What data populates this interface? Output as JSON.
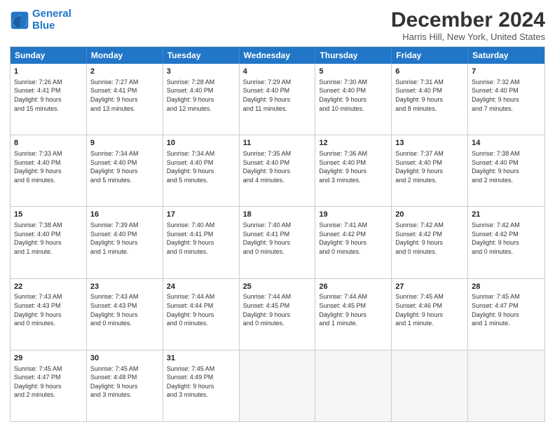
{
  "logo": {
    "line1": "General",
    "line2": "Blue"
  },
  "title": "December 2024",
  "location": "Harris Hill, New York, United States",
  "days_of_week": [
    "Sunday",
    "Monday",
    "Tuesday",
    "Wednesday",
    "Thursday",
    "Friday",
    "Saturday"
  ],
  "rows": [
    [
      {
        "day": "1",
        "info": "Sunrise: 7:26 AM\nSunset: 4:41 PM\nDaylight: 9 hours\nand 15 minutes."
      },
      {
        "day": "2",
        "info": "Sunrise: 7:27 AM\nSunset: 4:41 PM\nDaylight: 9 hours\nand 13 minutes."
      },
      {
        "day": "3",
        "info": "Sunrise: 7:28 AM\nSunset: 4:40 PM\nDaylight: 9 hours\nand 12 minutes."
      },
      {
        "day": "4",
        "info": "Sunrise: 7:29 AM\nSunset: 4:40 PM\nDaylight: 9 hours\nand 11 minutes."
      },
      {
        "day": "5",
        "info": "Sunrise: 7:30 AM\nSunset: 4:40 PM\nDaylight: 9 hours\nand 10 minutes."
      },
      {
        "day": "6",
        "info": "Sunrise: 7:31 AM\nSunset: 4:40 PM\nDaylight: 9 hours\nand 8 minutes."
      },
      {
        "day": "7",
        "info": "Sunrise: 7:32 AM\nSunset: 4:40 PM\nDaylight: 9 hours\nand 7 minutes."
      }
    ],
    [
      {
        "day": "8",
        "info": "Sunrise: 7:33 AM\nSunset: 4:40 PM\nDaylight: 9 hours\nand 6 minutes."
      },
      {
        "day": "9",
        "info": "Sunrise: 7:34 AM\nSunset: 4:40 PM\nDaylight: 9 hours\nand 5 minutes."
      },
      {
        "day": "10",
        "info": "Sunrise: 7:34 AM\nSunset: 4:40 PM\nDaylight: 9 hours\nand 5 minutes."
      },
      {
        "day": "11",
        "info": "Sunrise: 7:35 AM\nSunset: 4:40 PM\nDaylight: 9 hours\nand 4 minutes."
      },
      {
        "day": "12",
        "info": "Sunrise: 7:36 AM\nSunset: 4:40 PM\nDaylight: 9 hours\nand 3 minutes."
      },
      {
        "day": "13",
        "info": "Sunrise: 7:37 AM\nSunset: 4:40 PM\nDaylight: 9 hours\nand 2 minutes."
      },
      {
        "day": "14",
        "info": "Sunrise: 7:38 AM\nSunset: 4:40 PM\nDaylight: 9 hours\nand 2 minutes."
      }
    ],
    [
      {
        "day": "15",
        "info": "Sunrise: 7:38 AM\nSunset: 4:40 PM\nDaylight: 9 hours\nand 1 minute."
      },
      {
        "day": "16",
        "info": "Sunrise: 7:39 AM\nSunset: 4:40 PM\nDaylight: 9 hours\nand 1 minute."
      },
      {
        "day": "17",
        "info": "Sunrise: 7:40 AM\nSunset: 4:41 PM\nDaylight: 9 hours\nand 0 minutes."
      },
      {
        "day": "18",
        "info": "Sunrise: 7:40 AM\nSunset: 4:41 PM\nDaylight: 9 hours\nand 0 minutes."
      },
      {
        "day": "19",
        "info": "Sunrise: 7:41 AM\nSunset: 4:42 PM\nDaylight: 9 hours\nand 0 minutes."
      },
      {
        "day": "20",
        "info": "Sunrise: 7:42 AM\nSunset: 4:42 PM\nDaylight: 9 hours\nand 0 minutes."
      },
      {
        "day": "21",
        "info": "Sunrise: 7:42 AM\nSunset: 4:42 PM\nDaylight: 9 hours\nand 0 minutes."
      }
    ],
    [
      {
        "day": "22",
        "info": "Sunrise: 7:43 AM\nSunset: 4:43 PM\nDaylight: 9 hours\nand 0 minutes."
      },
      {
        "day": "23",
        "info": "Sunrise: 7:43 AM\nSunset: 4:43 PM\nDaylight: 9 hours\nand 0 minutes."
      },
      {
        "day": "24",
        "info": "Sunrise: 7:44 AM\nSunset: 4:44 PM\nDaylight: 9 hours\nand 0 minutes."
      },
      {
        "day": "25",
        "info": "Sunrise: 7:44 AM\nSunset: 4:45 PM\nDaylight: 9 hours\nand 0 minutes."
      },
      {
        "day": "26",
        "info": "Sunrise: 7:44 AM\nSunset: 4:45 PM\nDaylight: 9 hours\nand 1 minute."
      },
      {
        "day": "27",
        "info": "Sunrise: 7:45 AM\nSunset: 4:46 PM\nDaylight: 9 hours\nand 1 minute."
      },
      {
        "day": "28",
        "info": "Sunrise: 7:45 AM\nSunset: 4:47 PM\nDaylight: 9 hours\nand 1 minute."
      }
    ],
    [
      {
        "day": "29",
        "info": "Sunrise: 7:45 AM\nSunset: 4:47 PM\nDaylight: 9 hours\nand 2 minutes."
      },
      {
        "day": "30",
        "info": "Sunrise: 7:45 AM\nSunset: 4:48 PM\nDaylight: 9 hours\nand 3 minutes."
      },
      {
        "day": "31",
        "info": "Sunrise: 7:45 AM\nSunset: 4:49 PM\nDaylight: 9 hours\nand 3 minutes."
      },
      {
        "day": "",
        "info": ""
      },
      {
        "day": "",
        "info": ""
      },
      {
        "day": "",
        "info": ""
      },
      {
        "day": "",
        "info": ""
      }
    ]
  ]
}
